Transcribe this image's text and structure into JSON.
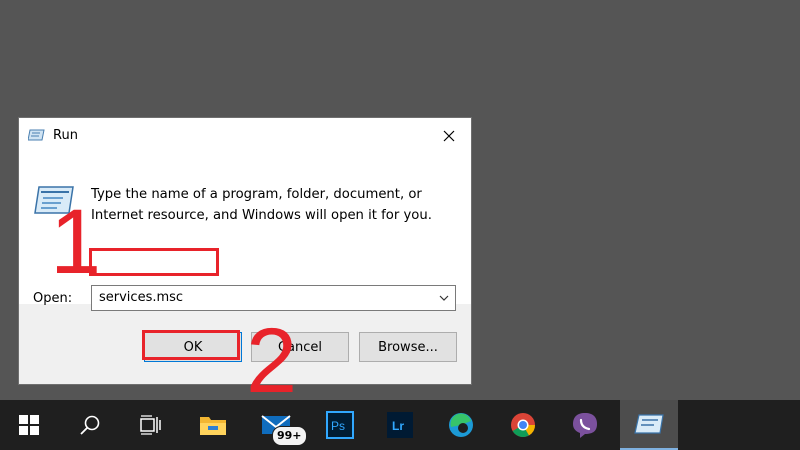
{
  "dialog": {
    "title": "Run",
    "description": "Type the name of a program, folder, document, or Internet resource, and Windows will open it for you.",
    "open_label": "Open:",
    "open_value": "services.msc",
    "buttons": {
      "ok": "OK",
      "cancel": "Cancel",
      "browse": "Browse..."
    }
  },
  "annotations": {
    "step1": "1",
    "step2": "2"
  },
  "taskbar": {
    "items": [
      {
        "icon": "windows-start-icon"
      },
      {
        "icon": "search-icon"
      },
      {
        "icon": "task-view-icon"
      },
      {
        "icon": "file-explorer-icon"
      },
      {
        "icon": "mail-icon",
        "badge": "99+"
      },
      {
        "icon": "photoshop-icon",
        "label": "Ps"
      },
      {
        "icon": "lightroom-icon",
        "label": "Lr"
      },
      {
        "icon": "edge-icon"
      },
      {
        "icon": "chrome-icon"
      },
      {
        "icon": "viber-icon"
      },
      {
        "icon": "run-icon"
      }
    ]
  },
  "colors": {
    "accent": "#0078d7",
    "annotation": "#e8232a",
    "desktop": "#555555",
    "taskbar": "#1f1f1f"
  }
}
